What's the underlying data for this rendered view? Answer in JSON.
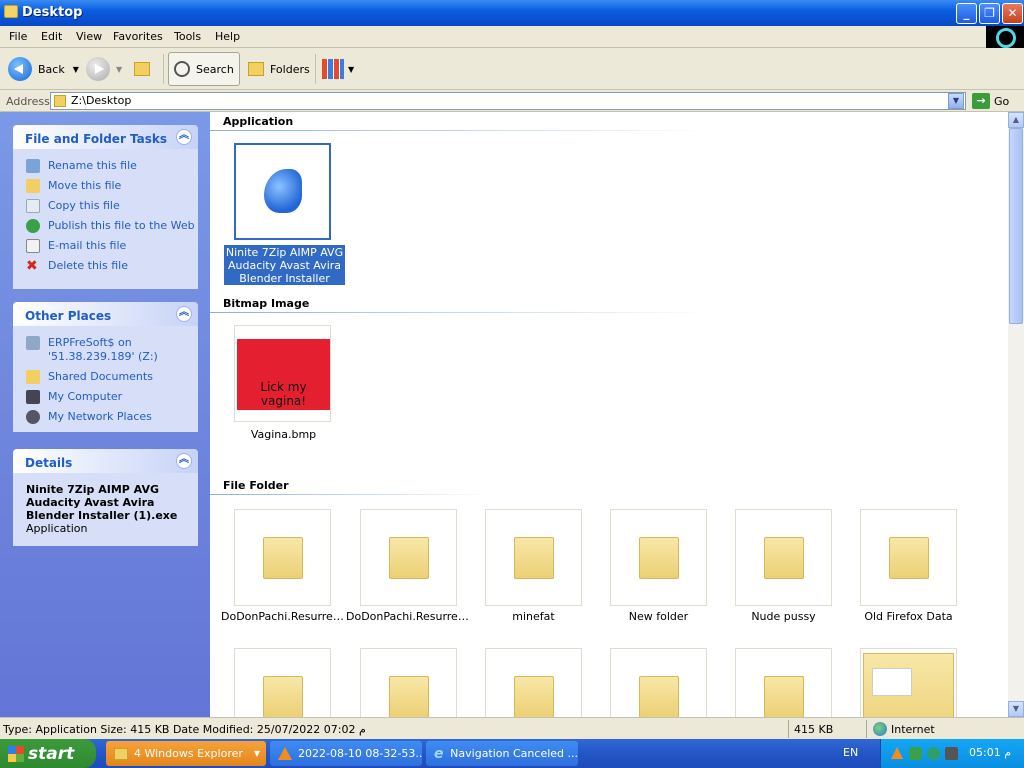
{
  "window": {
    "title": "Desktop"
  },
  "menu": [
    "File",
    "Edit",
    "View",
    "Favorites",
    "Tools",
    "Help"
  ],
  "toolbar": {
    "back": "Back",
    "search": "Search",
    "folders": "Folders"
  },
  "address": {
    "label": "Address",
    "value": "Z:\\Desktop",
    "go": "Go"
  },
  "tasks_panel": {
    "title": "File and Folder Tasks",
    "items": [
      "Rename this file",
      "Move this file",
      "Copy this file",
      "Publish this file to the Web",
      "E-mail this file",
      "Delete this file"
    ]
  },
  "places_panel": {
    "title": "Other Places",
    "items": [
      "ERPFreSoft$ on '51.38.239.189' (Z:)",
      "Shared Documents",
      "My Computer",
      "My Network Places"
    ]
  },
  "details_panel": {
    "title": "Details",
    "name": "Ninite 7Zip AIMP AVG Audacity Avast Avira Blender Installer (1).exe",
    "type": "Application"
  },
  "groups": {
    "application": "Application",
    "bitmap": "Bitmap Image",
    "folder": "File Folder"
  },
  "files": {
    "app_name": "Ninite 7Zip AIMP AVG Audacity Avast Avira Blender Installer (1).exe",
    "bmp_name": "Vagina.bmp",
    "bmp_text": "Lick my vagina!"
  },
  "folders": [
    "DoDonPachi.Resurrec...",
    "DoDonPachi.Resurrec...",
    "minefat",
    "New folder",
    "Nude pussy",
    "Old Firefox Data"
  ],
  "status": {
    "main": "Type: Application Size: 415 KB Date Modified: 25/07/2022 07:02 م",
    "size": "415 KB",
    "zone": "Internet"
  },
  "taskbar": {
    "start": "start",
    "tasks": [
      "4 Windows Explorer",
      "2022-08-10 08-32-53...",
      "Navigation Canceled ..."
    ],
    "lang": "EN",
    "clock": "05:01 م"
  }
}
